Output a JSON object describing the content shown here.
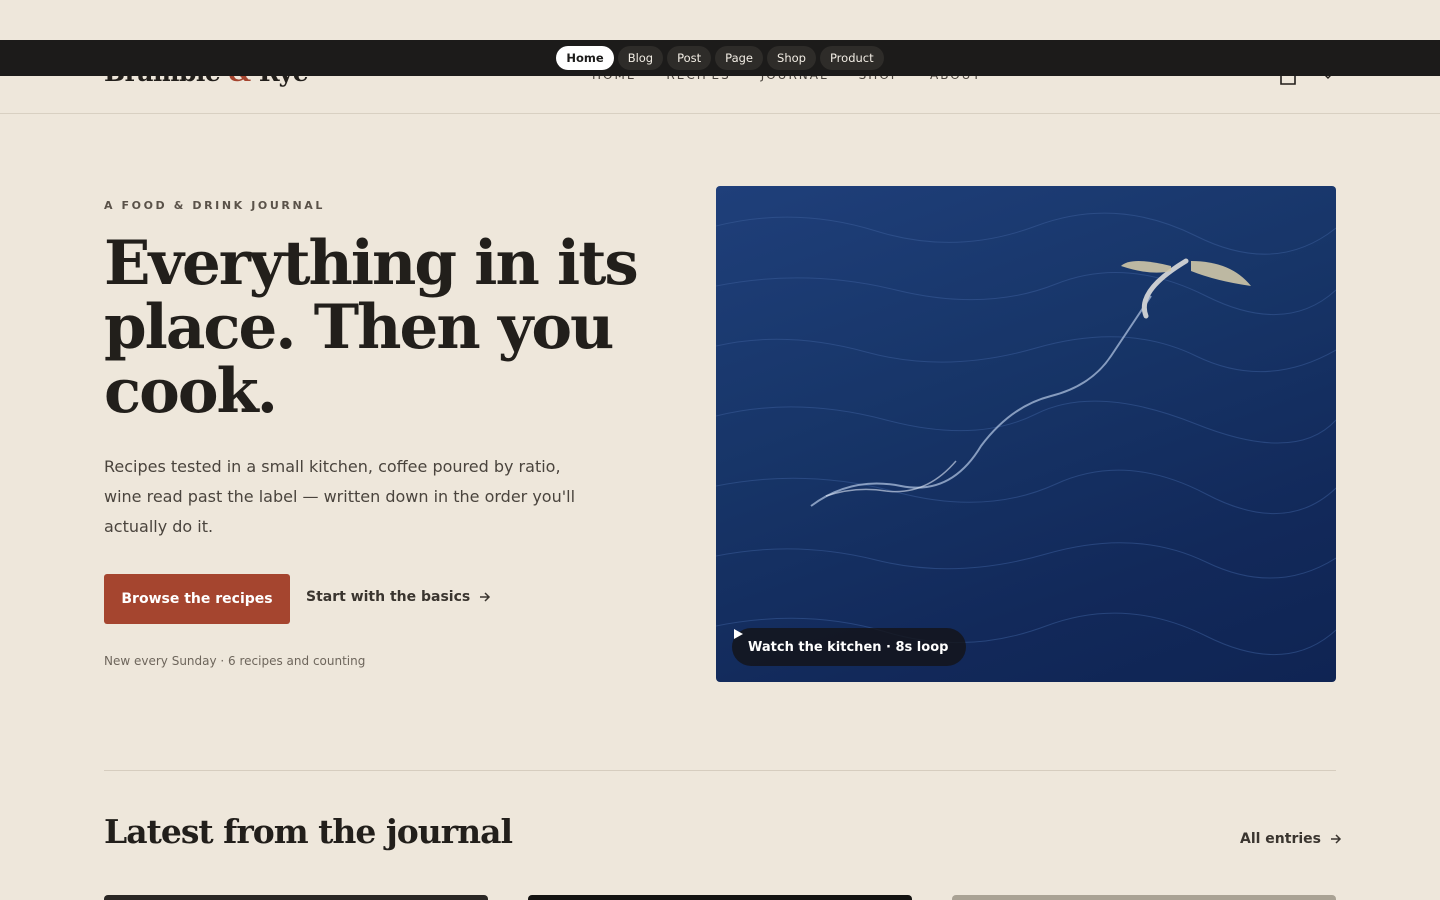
{
  "site": {
    "logo_part1": "Bramble ",
    "logo_amp": "&",
    "logo_part2": " Rye",
    "nav": [
      "HOME",
      "RECIPES",
      "JOURNAL",
      "SHOP",
      "ABOUT"
    ]
  },
  "preview_bar": {
    "pills": [
      "Home",
      "Blog",
      "Post",
      "Page",
      "Shop",
      "Product"
    ],
    "active": "Home"
  },
  "hero": {
    "eyebrow": "A FOOD & DRINK JOURNAL",
    "headline": "Everything in its place. Then you cook.",
    "lede": "Recipes tested in a small kitchen, coffee poured by ratio, wine read past the label — written down in the order you'll actually do it.",
    "primary_cta": "Browse the recipes",
    "secondary_cta": "Start with the basics",
    "note": "New every Sunday · 6 recipes and counting",
    "video_chip": "Watch the kitchen · 8s loop"
  },
  "journal": {
    "title": "Latest from the journal",
    "all_link": "All entries"
  },
  "icons": [
    "cart-icon",
    "menu-icon",
    "play-icon",
    "arrow-right-icon"
  ],
  "colors": {
    "background": "#eee7db",
    "accent": "#a5452f",
    "ink": "#221f1b",
    "preview_bar": "#1c1b1a"
  }
}
